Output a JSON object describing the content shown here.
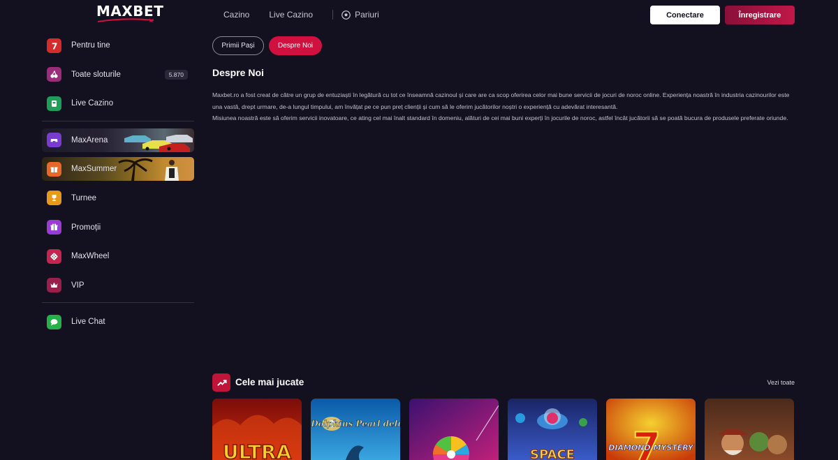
{
  "brand": {
    "logo_text": "MAXBET"
  },
  "topnav": {
    "items": [
      {
        "label": "Cazino"
      },
      {
        "label": "Live Cazino"
      },
      {
        "label": "Pariuri"
      }
    ]
  },
  "auth": {
    "login_label": "Conectare",
    "register_label": "Înregistrare"
  },
  "sidebar": {
    "items": [
      {
        "label": "Pentru tine",
        "icon": "seven-icon",
        "color": "#d42b2b"
      },
      {
        "label": "Toate sloturile",
        "icon": "cherry-icon",
        "color": "#9b2c7a",
        "badge": "5.870"
      },
      {
        "label": "Live Cazino",
        "icon": "live-card-icon",
        "color": "#1f9e5a"
      },
      {
        "label": "MaxArena",
        "icon": "controller-icon",
        "color": "#7a3bd1"
      },
      {
        "label": "MaxSummer",
        "icon": "gift-box-icon",
        "color": "#e8672a"
      },
      {
        "label": "Turnee",
        "icon": "trophy-icon",
        "color": "#e59a1a"
      },
      {
        "label": "Promoții",
        "icon": "gift-icon",
        "color": "#9a3bd8"
      },
      {
        "label": "MaxWheel",
        "icon": "dice-icon",
        "color": "#c2254e"
      },
      {
        "label": "VIP",
        "icon": "crown-icon",
        "color": "#9a1f4a"
      },
      {
        "label": "Live Chat",
        "icon": "chat-icon",
        "color": "#27b04a"
      }
    ]
  },
  "tabs": [
    {
      "label": "Primii Pași",
      "active": false
    },
    {
      "label": "Despre Noi",
      "active": true
    }
  ],
  "page": {
    "title": "Despre Noi",
    "paragraph1": "Maxbet.ro a fost creat de către un grup de entuziaști în legătură cu tot ce înseamnă cazinoul și care are ca scop oferirea celor mai bune servicii de jocuri de noroc online. Experiența noastră în industria cazinourilor este una vastă, drept urmare, de-a lungul timpului, am învățat pe ce pun preț clienții și cum să le oferim jucătorilor noștri o experiență cu adevărat interesantă.",
    "paragraph2": "Misiunea noastră este să oferim servicii inovatoare, ce ating cel mai înalt standard în domeniu, alături de cei mai buni experți în jocurile de noroc, astfel încât jucătorii să se poată bucura de produsele preferate oriunde."
  },
  "most_played": {
    "title": "Cele mai jucate",
    "view_all": "Vezi toate",
    "games": [
      {
        "art_text": "ULTRA",
        "colors": [
          "#7a0e08",
          "#d12a0f"
        ]
      },
      {
        "art_text": "Dolphins Pearl deluxe",
        "colors": [
          "#0a5aa8",
          "#3aa6e0"
        ]
      },
      {
        "art_text": "",
        "colors": [
          "#3b1170",
          "#c0207a"
        ]
      },
      {
        "art_text": "SPACE",
        "colors": [
          "#1a2466",
          "#3a5bc8"
        ]
      },
      {
        "art_text": "DIAMOND MYSTERY",
        "colors": [
          "#c83a08",
          "#f5a010"
        ]
      },
      {
        "art_text": "",
        "colors": [
          "#4a2a1a",
          "#8a4a2a"
        ]
      }
    ]
  }
}
